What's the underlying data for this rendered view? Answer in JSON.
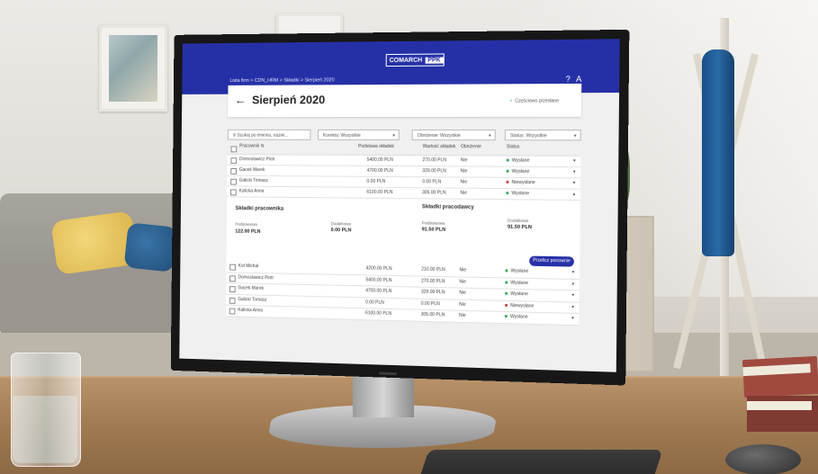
{
  "colors": {
    "brand": "#2630a6",
    "status_green": "#30a450",
    "status_red": "#d23a3a"
  },
  "app": {
    "logo_left": "COMARCH",
    "logo_right": "PPK",
    "breadcrumb": "Lista firm > CDN_HRM > Składki > Sierpień 2020",
    "icons": [
      "help-icon",
      "user-icon"
    ],
    "help_glyph": "?",
    "user_glyph": "A"
  },
  "header": {
    "back_glyph": "←",
    "title": "Sierpień 2020",
    "status_glyph": "✓",
    "status": "Częściowo przesłane"
  },
  "filters": {
    "search_placeholder": "Szukaj po imieniu, nazwi...",
    "korekta": "Korekta: Wszystkie",
    "oboczenie": "Obniżenie: Wszystkie",
    "status": "Status: Wszystkie",
    "chevron": "▾",
    "search_glyph": "⚲"
  },
  "table": {
    "columns": {
      "employee": "Pracownik ⇅",
      "base": "Podstawa składek",
      "value": "Wartość składek",
      "reduction": "Obniżenie",
      "status": "Status"
    },
    "rows": [
      {
        "name": "Domoslawicz Piotr",
        "base": "5400.00 PLN",
        "value": "270.00 PLN",
        "reduction": "Nie",
        "status": "Wysłane",
        "color": "#30a450"
      },
      {
        "name": "Gacek Marek",
        "base": "4700.00 PLN",
        "value": "329.00 PLN",
        "reduction": "Nie",
        "status": "Wysłane",
        "color": "#30a450"
      },
      {
        "name": "Galicki Tomasz",
        "base": "0.00 PLN",
        "value": "0.00 PLN",
        "reduction": "Nie",
        "status": "Niewysłane",
        "color": "#d23a3a"
      },
      {
        "name": "Kalicka Anna",
        "base": "6100.00 PLN",
        "value": "305.00 PLN",
        "reduction": "Nie",
        "status": "Wysłane",
        "color": "#30a450"
      }
    ]
  },
  "details": {
    "employee_heading": "Składki pracownika",
    "employer_heading": "Składki pracodawcy",
    "base_label": "Podstawowa",
    "extra_label": "Dodatkowa",
    "emp_base": "122.00 PLN",
    "emp_extra": "0.00 PLN",
    "er_base": "91.50 PLN",
    "er_extra": "91.50 PLN",
    "button": "Przelicz ponownie"
  },
  "table2": {
    "rows": [
      {
        "name": "Kot Michał",
        "base": "4200.00 PLN",
        "value": "210.00 PLN",
        "reduction": "Nie",
        "status": "Wysłane",
        "color": "#30a450"
      },
      {
        "name": "Domoslawicz Piotr",
        "base": "5400.00 PLN",
        "value": "270.00 PLN",
        "reduction": "Nie",
        "status": "Wysłane",
        "color": "#30a450"
      },
      {
        "name": "Gacek Marek",
        "base": "4700.00 PLN",
        "value": "329.00 PLN",
        "reduction": "Nie",
        "status": "Wysłane",
        "color": "#30a450"
      },
      {
        "name": "Galicki Tomasz",
        "base": "0.00 PLN",
        "value": "0.00 PLN",
        "reduction": "Nie",
        "status": "Niewysłane",
        "color": "#d23a3a"
      },
      {
        "name": "Kalicka Anna",
        "base": "6100.00 PLN",
        "value": "305.00 PLN",
        "reduction": "Nie",
        "status": "Wysłane",
        "color": "#30a450"
      }
    ]
  }
}
